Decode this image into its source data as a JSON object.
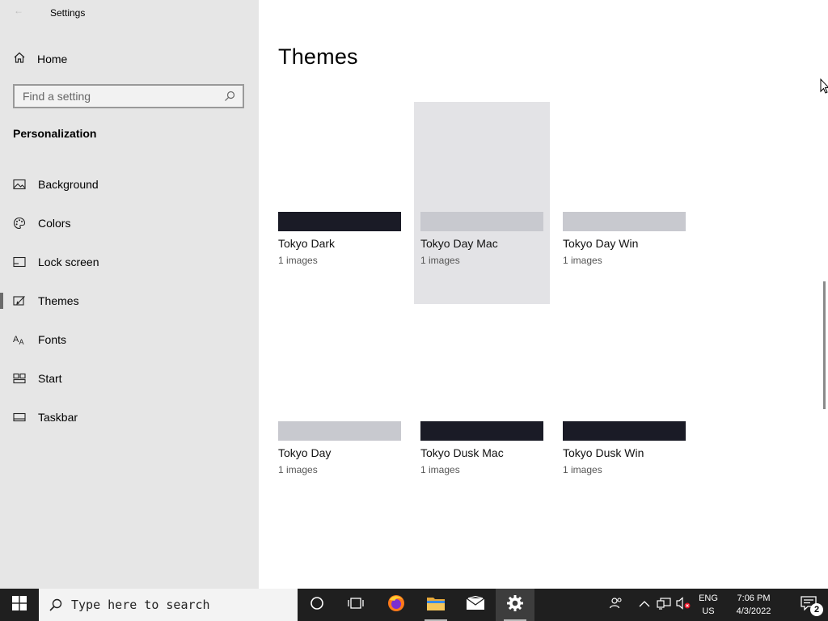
{
  "window": {
    "title": "Settings"
  },
  "sidebar": {
    "home_label": "Home",
    "search_placeholder": "Find a setting",
    "section_title": "Personalization",
    "items": [
      {
        "label": "Background",
        "icon": "picture-icon"
      },
      {
        "label": "Colors",
        "icon": "palette-icon"
      },
      {
        "label": "Lock screen",
        "icon": "lock-screen-icon"
      },
      {
        "label": "Themes",
        "icon": "themes-icon",
        "selected": true
      },
      {
        "label": "Fonts",
        "icon": "fonts-icon"
      },
      {
        "label": "Start",
        "icon": "start-icon"
      },
      {
        "label": "Taskbar",
        "icon": "taskbar-icon"
      }
    ]
  },
  "main": {
    "title": "Themes",
    "themes": [
      {
        "name": "Tokyo Dark",
        "count": "1 images",
        "color": "#1a1b26"
      },
      {
        "name": "Tokyo Day Mac",
        "count": "1 images",
        "color": "#c8c9cf"
      },
      {
        "name": "Tokyo Day Win",
        "count": "1 images",
        "color": "#c8c9cf"
      },
      {
        "name": "Tokyo Day",
        "count": "1 images",
        "color": "#c8c9cf"
      },
      {
        "name": "Tokyo Dusk Mac",
        "count": "1 images",
        "color": "#1a1b26"
      },
      {
        "name": "Tokyo Dusk Win",
        "count": "1 images",
        "color": "#1a1b26"
      }
    ]
  },
  "taskbar": {
    "search_placeholder": "Type here to search",
    "language_line1": "ENG",
    "language_line2": "US",
    "time": "7:06 PM",
    "date": "4/3/2022",
    "notification_count": "2"
  }
}
